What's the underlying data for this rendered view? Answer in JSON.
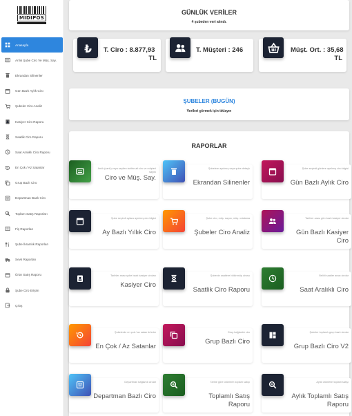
{
  "logo": {
    "brand": "MIDIPOS"
  },
  "sidebar": {
    "items": [
      {
        "label": "Anasayfa",
        "icon": "dashboard-icon"
      },
      {
        "label": "Anlık Şube Ciro Ve Müş. Say.",
        "icon": "list-icon"
      },
      {
        "label": "Ekrandan Silinenler",
        "icon": "trash-icon"
      },
      {
        "label": "Gün Bazlı Aylık Ciro",
        "icon": "calendar-icon"
      },
      {
        "label": "Şubeler Ciro Analiz",
        "icon": "cart-icon"
      },
      {
        "label": "Kasiyer Ciro Raporu",
        "icon": "badge-icon"
      },
      {
        "label": "Saatlik Ciro Raporu",
        "icon": "hourglass-icon"
      },
      {
        "label": "Saat Aralıklı Ciro Raporu",
        "icon": "clock-icon"
      },
      {
        "label": "En Çok / Az Satanlar",
        "icon": "history-icon"
      },
      {
        "label": "Grup Bazlı Ciro",
        "icon": "copy-icon"
      },
      {
        "label": "Departman Bazlı Ciro",
        "icon": "building-icon"
      },
      {
        "label": "Toplam Satış Raporları",
        "icon": "search-icon"
      },
      {
        "label": "Fiş Raporları",
        "icon": "receipt-icon"
      },
      {
        "label": "Şube İkramlık Raporları",
        "icon": "utensils-icon"
      },
      {
        "label": "Sevk Raporları",
        "icon": "truck-icon"
      },
      {
        "label": "Ürün Satış Raporu",
        "icon": "box-icon"
      },
      {
        "label": "Şube Ciro Erişim",
        "icon": "lock-icon"
      },
      {
        "label": "Çıkış",
        "icon": "logout-icon"
      }
    ]
  },
  "daily": {
    "title": "GÜNLÜK VERİLER",
    "subtitle": "4 şubeden veri alındı.",
    "stats": [
      {
        "label": "T. Ciro :",
        "value": "8.877,93",
        "unit": "TL",
        "icon": "lira-icon"
      },
      {
        "label": "T. Müşteri :",
        "value": "246",
        "icon": "users-icon"
      },
      {
        "label": "Müşt. Ort. :",
        "value": "35,68",
        "unit": "TL",
        "icon": "basket-icon"
      }
    ]
  },
  "branches": {
    "title": "ŞUBELER (BUGÜN)",
    "subtitle": "Verileri görmek için tıklayın"
  },
  "reports": {
    "title": "RAPORLAR",
    "items": [
      {
        "desc": "Anlık (canlı) veya seçilen tarihte alt ciro ve müşteri sayısı",
        "title": "Ciro ve Müş. Say.",
        "icon": "list-icon",
        "color": "#1b5e20",
        "color2": "#43a047"
      },
      {
        "desc": "Şubelere ayrılmış veya şube detaylı",
        "title": "Ekrandan Silinenler",
        "icon": "trash-icon",
        "color": "#4fc3f7",
        "color2": "#3f51b5"
      },
      {
        "desc": "Şube seçimli günlere ayrılmış ciro bilgisi",
        "title": "Gün Bazlı Aylık Ciro",
        "icon": "calendar-icon",
        "color": "#c2185b",
        "color2": "#880e4f"
      },
      {
        "desc": "Şube seçimli aylara ayrılmış ciro bilgisi",
        "title": "Ay Bazlı Yıllık Ciro",
        "icon": "calendar-icon",
        "color": "#1c2333",
        "color2": "#1c2333"
      },
      {
        "desc": "Şube ciro, müş. sayısı, müş. ortalama",
        "title": "Şubeler Ciro Analiz",
        "icon": "cart-icon",
        "color": "#ff9800",
        "color2": "#f44336"
      },
      {
        "desc": "Tarihler arası gün bazlı kasiyer cirolar",
        "title": "Gün Bazlı Kasiyer Ciro",
        "icon": "users-icon",
        "color": "#ad1457",
        "color2": "#6a1b9a"
      },
      {
        "desc": "Tarihler arası şube bazlı kasiyer ciroları",
        "title": "Kasiyer Ciro",
        "icon": "badge-icon",
        "color": "#1c2333",
        "color2": "#1c2333"
      },
      {
        "desc": "Şubenin saatlere bölünmüş cirosu",
        "title": "Saatlik Ciro Raporu",
        "icon": "hourglass-icon",
        "color": "#1c2333",
        "color2": "#1c2333"
      },
      {
        "desc": "Belirli saatler arası cirolar",
        "title": "Saat Aralıklı Ciro",
        "icon": "clock-icon",
        "color": "#2e7d32",
        "color2": "#1b5e20"
      },
      {
        "desc": "Şubelerde en çok / az satan ürünler",
        "title": "En Çok / Az Satanlar",
        "icon": "history-icon",
        "color": "#ff9800",
        "color2": "#f44336"
      },
      {
        "desc": "Grup bağlantılı ciro",
        "title": "Grup Bazlı Ciro",
        "icon": "copy-icon",
        "color": "#c2185b",
        "color2": "#880e4f"
      },
      {
        "desc": "Şubeler toplamlı grup bazlı cirolar",
        "title": "Grup Bazlı Ciro V2",
        "icon": "layout-icon",
        "color": "#1c2333",
        "color2": "#1c2333"
      },
      {
        "desc": "Departman bağlamlı cirolar",
        "title": "Departman Bazlı Ciro",
        "icon": "building-icon",
        "color": "#4fc3f7",
        "color2": "#3f51b5"
      },
      {
        "desc": "Tarihe göre ürünlerin toplam satışı",
        "title": "Toplamlı Satış Raporu",
        "icon": "search-icon",
        "color": "#2e7d32",
        "color2": "#1b5e20"
      },
      {
        "desc": "Aylık ürünlerin toplam satışı",
        "title": "Aylık Toplamlı Satış Raporu",
        "icon": "search-icon",
        "color": "#1c2333",
        "color2": "#1c2333"
      }
    ]
  }
}
